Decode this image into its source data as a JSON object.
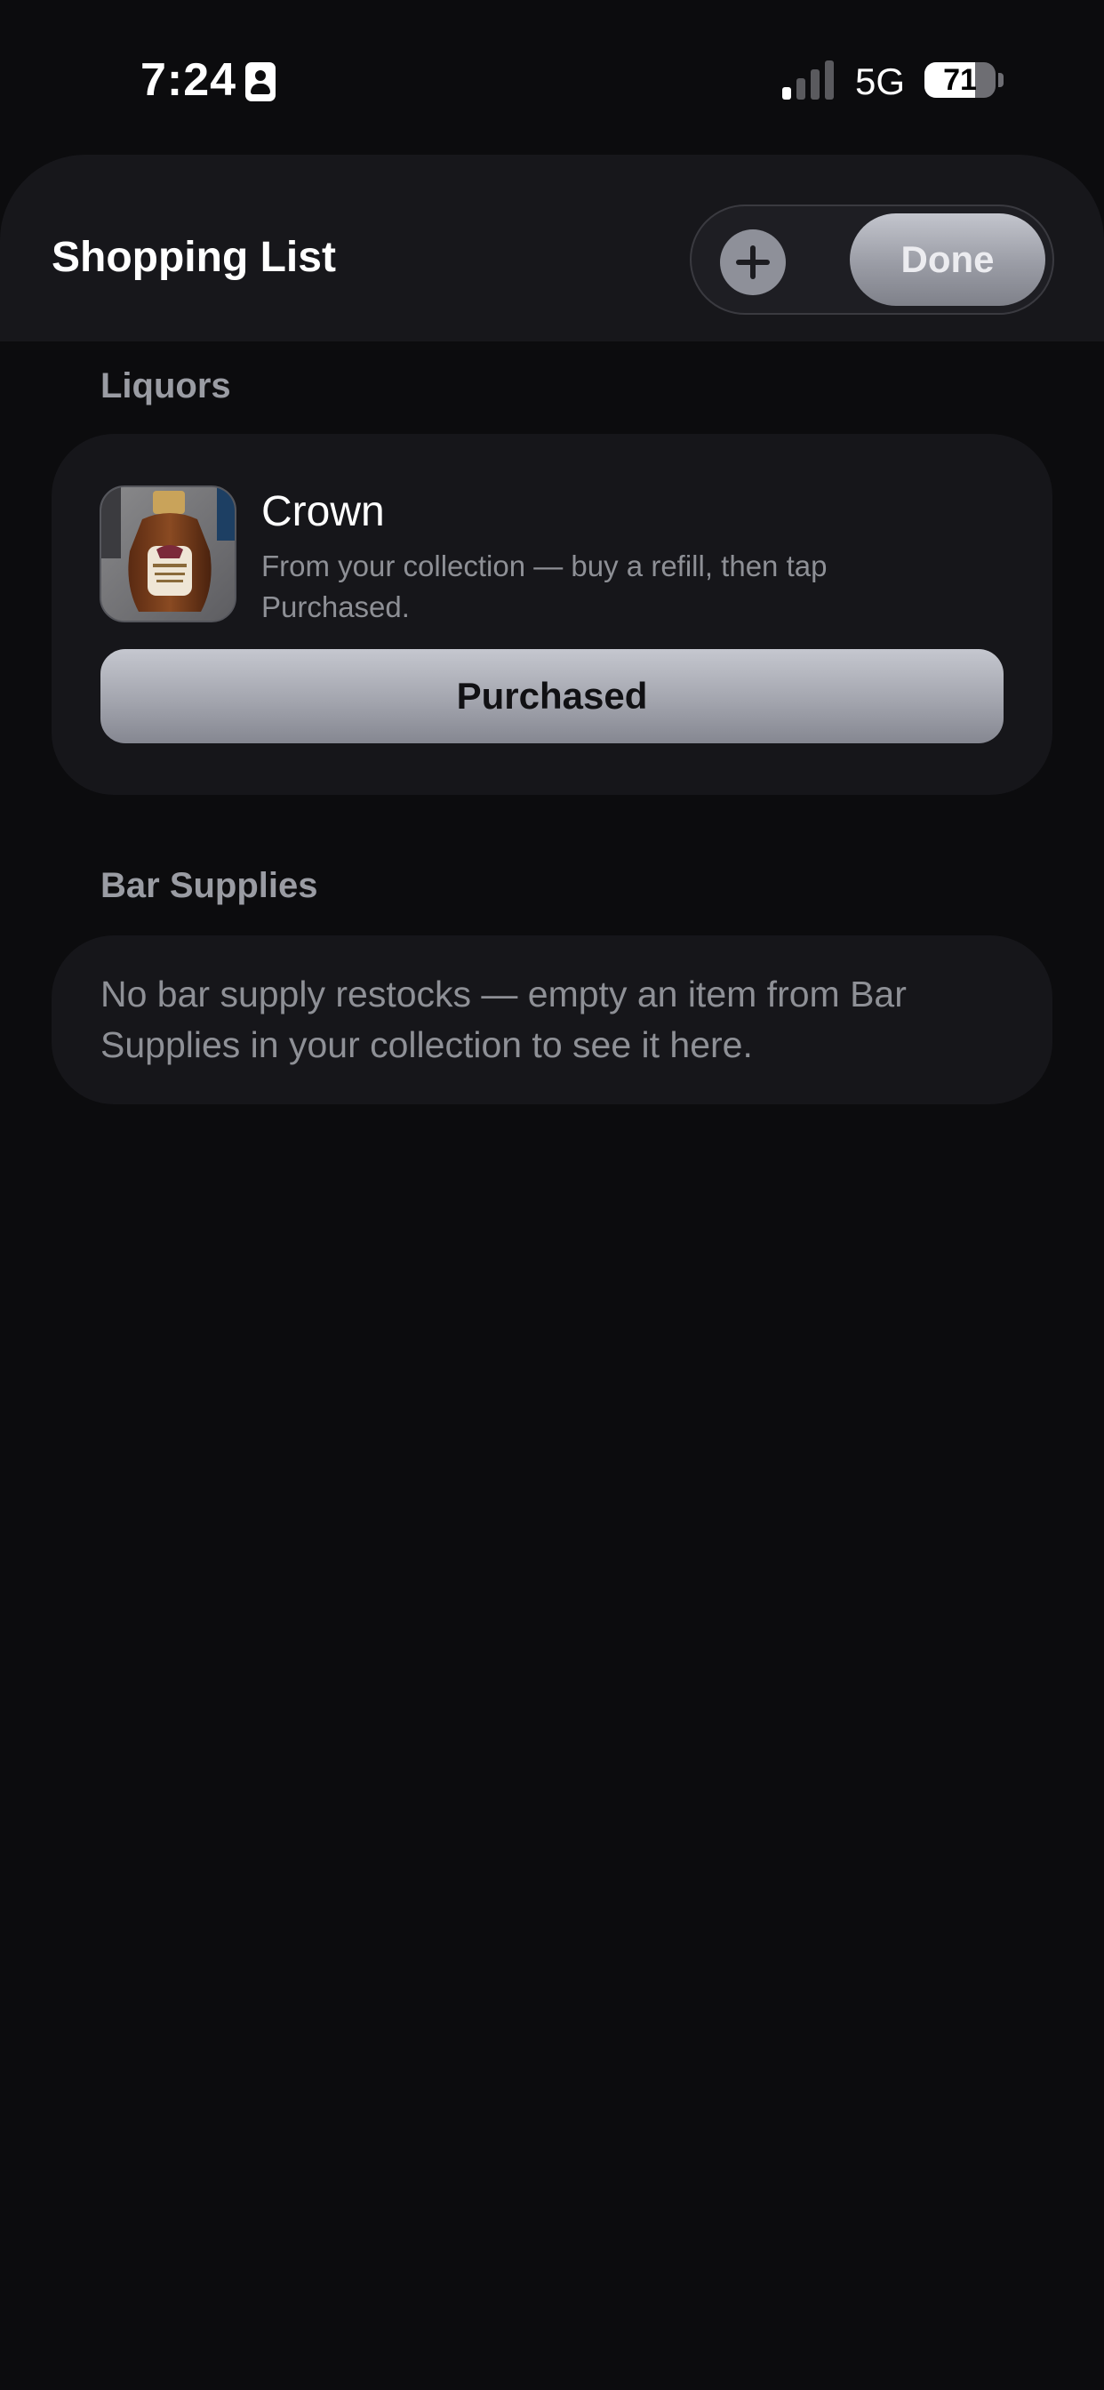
{
  "status_bar": {
    "time": "7:24",
    "network": "5G",
    "battery_level": "71",
    "battery_fraction": 0.71,
    "signal_bars_active": 1,
    "signal_bars_total": 4
  },
  "header": {
    "title": "Shopping List",
    "done_label": "Done"
  },
  "sections": {
    "liquors": {
      "header": "Liquors",
      "item": {
        "name": "Crown",
        "subtitle": "From your collection — buy a refill, then tap Purchased.",
        "button_label": "Purchased",
        "image_icon": "liquor-bottle-photo"
      }
    },
    "bar_supplies": {
      "header": "Bar Supplies",
      "empty_message": "No bar supply restocks — empty an item from Bar Supplies in your collection to see it here."
    }
  },
  "colors": {
    "background": "#0c0c0e",
    "card": "#16161a",
    "header_sheet": "#17171b",
    "secondary_text": "#8e9096",
    "section_header": "#9a9ca3"
  }
}
